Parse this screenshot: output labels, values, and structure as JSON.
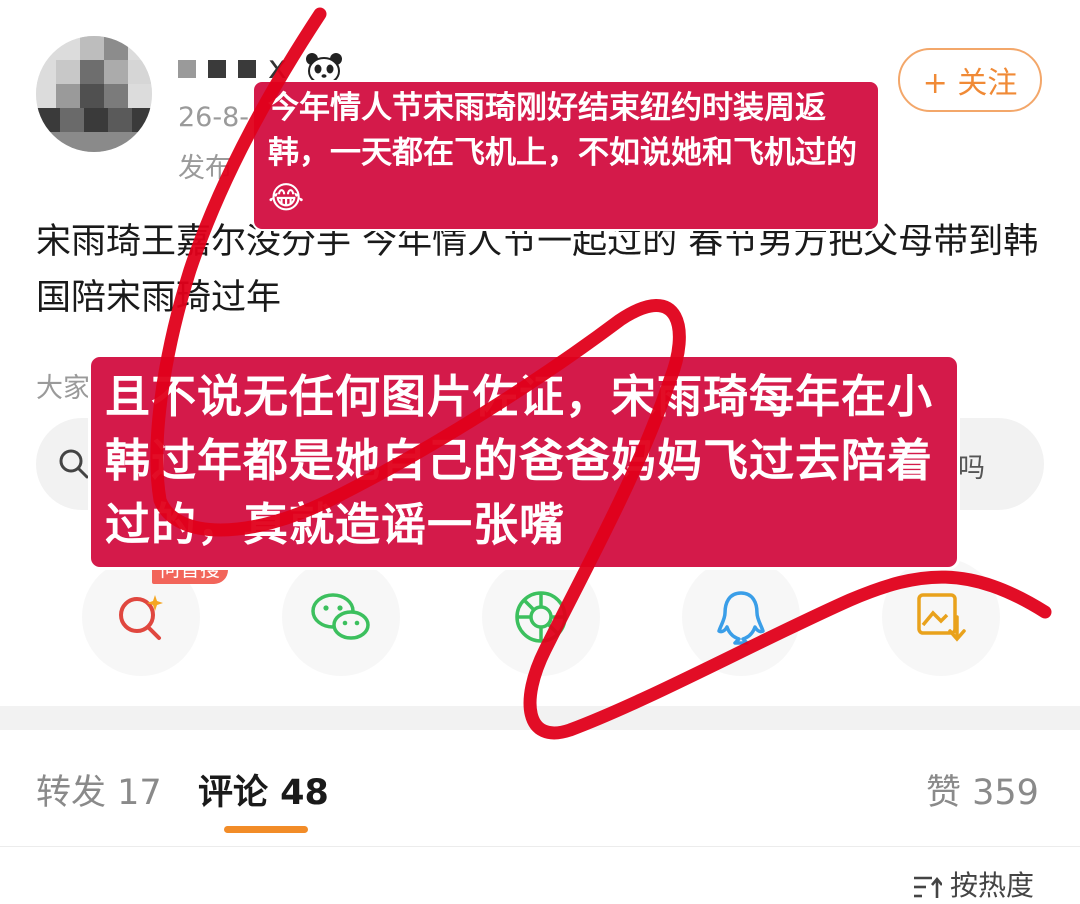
{
  "post": {
    "username_suffix": "x",
    "date": "26-8-",
    "source": "发布",
    "follow_label": "+ 关注",
    "text": "宋雨琦王嘉尔没分手 今年情人节一起过的 春节男方把父母带到韩国陪宋雨琦过年"
  },
  "search": {
    "hint": "大家",
    "tail": "吗"
  },
  "share": {
    "badge": "问智搜",
    "items": [
      {
        "icon": "ai-search-icon",
        "color": "#e0473f"
      },
      {
        "icon": "wechat-icon",
        "color": "#3cc05e"
      },
      {
        "icon": "moments-icon",
        "color": "#3cc05e"
      },
      {
        "icon": "qq-icon",
        "color": "#3a9ee8"
      },
      {
        "icon": "save-image-icon",
        "color": "#e9a21c"
      }
    ]
  },
  "tabs": {
    "repost": "转发 17",
    "comments": "评论 48",
    "likes": "赞 359",
    "sort": "按热度"
  },
  "overlay": {
    "caption1": "今年情人节宋雨琦刚好结束纽约时装周返韩，一天都在飞机上，不如说她和飞机过的😂",
    "caption2": "且不说无任何图片佐证，宋雨琦每年在小韩过年都是她自己的爸爸妈妈飞过去陪着过的，真就造谣一张嘴"
  },
  "colors": {
    "accent": "#f08a36",
    "caption_bg": "#d41a4a",
    "scribble": "#e0001a"
  }
}
